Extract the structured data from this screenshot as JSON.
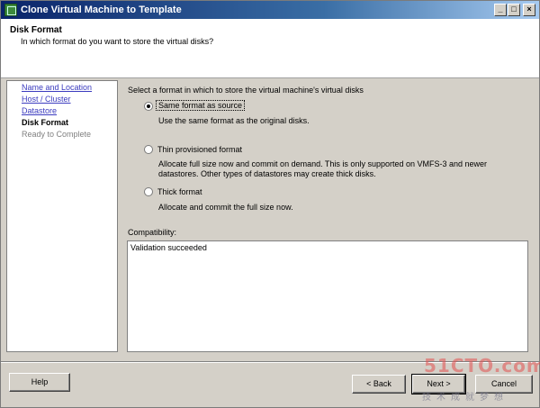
{
  "window": {
    "title": "Clone Virtual Machine to Template",
    "controls": {
      "minimize": "_",
      "maximize": "□",
      "close": "×"
    }
  },
  "header": {
    "title": "Disk Format",
    "subtitle": "In which format do you want to store the virtual disks?"
  },
  "nav": {
    "items": [
      {
        "label": "Name and Location",
        "state": "link"
      },
      {
        "label": "Host / Cluster",
        "state": "link"
      },
      {
        "label": "Datastore",
        "state": "link"
      },
      {
        "label": "Disk Format",
        "state": "current"
      },
      {
        "label": "Ready to Complete",
        "state": "disabled"
      }
    ]
  },
  "main": {
    "instruction": "Select a format in which to store the virtual machine's virtual disks",
    "options": [
      {
        "label": "Same format as source",
        "desc1": "Use the same format as the original disks.",
        "desc2": "",
        "selected": true
      },
      {
        "label": "Thin provisioned format",
        "desc1": "Allocate full size now and commit on demand. This is only supported on VMFS-3 and newer",
        "desc2": "datastores. Other types of datastores may create thick disks.",
        "selected": false
      },
      {
        "label": "Thick format",
        "desc1": "Allocate and commit the full size now.",
        "desc2": "",
        "selected": false
      }
    ],
    "compat_label": "Compatibility:",
    "compat_text": "Validation succeeded"
  },
  "footer": {
    "help": "Help",
    "back": "< Back",
    "next": "Next >",
    "cancel": "Cancel"
  },
  "watermark": {
    "brand": "51CTO.com",
    "sub": "技术成就梦想"
  }
}
